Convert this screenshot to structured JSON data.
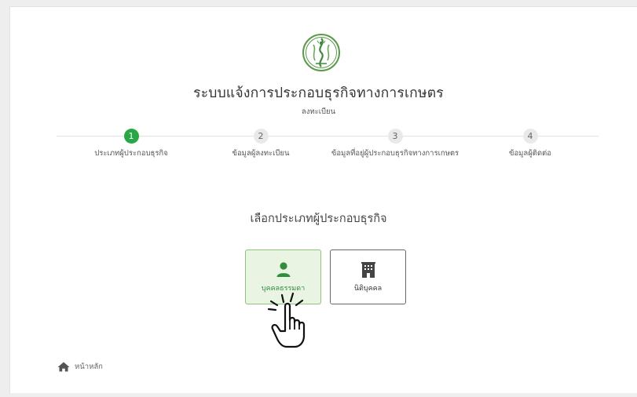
{
  "header": {
    "title": "ระบบแจ้งการประกอบธุรกิจทางการเกษตร",
    "subtitle": "ลงทะเบียน"
  },
  "steps": [
    {
      "number": "1",
      "label": "ประเภทผู้ประกอบธุรกิจ",
      "active": true
    },
    {
      "number": "2",
      "label": "ข้อมูลผู้ลงทะเบียน",
      "active": false
    },
    {
      "number": "3",
      "label": "ข้อมูลที่อยู่ผู้ประกอบธุรกิจทางการเกษตร",
      "active": false
    },
    {
      "number": "4",
      "label": "ข้อมูลผู้ติดต่อ",
      "active": false
    }
  ],
  "main": {
    "prompt": "เลือกประเภทผู้ประกอบธุรกิจ",
    "options": [
      {
        "label": "บุคคลธรรมดา",
        "icon": "person-icon",
        "selected": true
      },
      {
        "label": "นิติบุคคล",
        "icon": "building-icon",
        "selected": false
      }
    ]
  },
  "footer": {
    "home_label": "หน้าหลัก",
    "home_icon": "home-icon"
  },
  "colors": {
    "accent": "#27a844",
    "selected_bg": "#e9f4e2",
    "selected_border": "#8cc57a",
    "selected_text": "#2f8d3c"
  }
}
